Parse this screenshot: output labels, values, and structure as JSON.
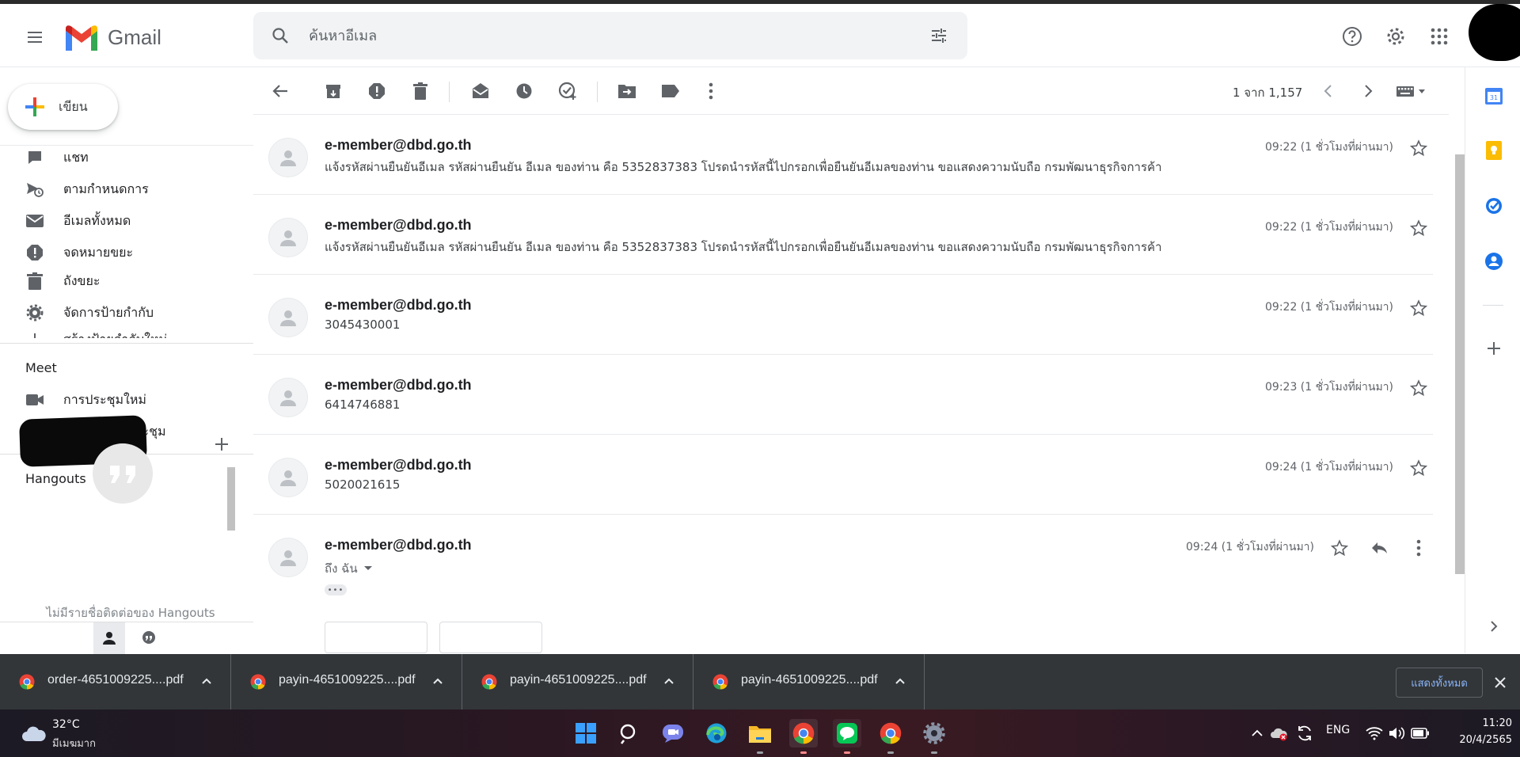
{
  "header": {
    "app_name": "Gmail",
    "search_placeholder": "ค้นหาอีเมล"
  },
  "compose": {
    "label": "เขียน"
  },
  "nav": {
    "items": [
      {
        "label": "แชท",
        "icon": "chat-icon"
      },
      {
        "label": "ตามกำหนดการ",
        "icon": "scheduled-icon"
      },
      {
        "label": "อีเมลทั้งหมด",
        "icon": "mail-icon"
      },
      {
        "label": "จดหมายขยะ",
        "icon": "spam-icon"
      },
      {
        "label": "ถังขยะ",
        "icon": "trash-icon"
      },
      {
        "label": "จัดการป้ายกำกับ",
        "icon": "gear-icon"
      },
      {
        "label": "สร้างป้ายกำกับใหม่",
        "icon": "plus-icon"
      }
    ]
  },
  "meet": {
    "title": "Meet",
    "items": [
      {
        "label": "การประชุมใหม่",
        "icon": "video-icon"
      },
      {
        "label": "เข้าร่วมการประชุม",
        "icon": "keyboard-icon"
      }
    ]
  },
  "hangouts": {
    "title": "Hangouts",
    "empty_text": "ไม่มีรายชื่อติดต่อของ Hangouts"
  },
  "toolbar": {
    "page_count": "1 จาก 1,157"
  },
  "messages": [
    {
      "from": "e-member@dbd.go.th",
      "snippet": "แจ้งรหัสผ่านยืนยันอีเมล รหัสผ่านยืนยัน อีเมล ของท่าน คือ 5352837383 โปรดนำรหัสนี้ไปกรอกเพื่อยืนยันอีเมลของท่าน ขอแสดงความนับถือ กรมพัฒนาธุรกิจการค้า",
      "time": "09:22 (1 ชั่วโมงที่ผ่านมา)"
    },
    {
      "from": "e-member@dbd.go.th",
      "snippet": "แจ้งรหัสผ่านยืนยันอีเมล รหัสผ่านยืนยัน อีเมล ของท่าน คือ 5352837383 โปรดนำรหัสนี้ไปกรอกเพื่อยืนยันอีเมลของท่าน ขอแสดงความนับถือ กรมพัฒนาธุรกิจการค้า",
      "time": "09:22 (1 ชั่วโมงที่ผ่านมา)"
    },
    {
      "from": "e-member@dbd.go.th",
      "snippet": "3045430001",
      "time": "09:22 (1 ชั่วโมงที่ผ่านมา)"
    },
    {
      "from": "e-member@dbd.go.th",
      "snippet": "6414746881",
      "time": "09:23 (1 ชั่วโมงที่ผ่านมา)"
    },
    {
      "from": "e-member@dbd.go.th",
      "snippet": "5020021615",
      "time": "09:24 (1 ชั่วโมงที่ผ่านมา)"
    },
    {
      "from": "e-member@dbd.go.th",
      "to": "ถึง ฉัน",
      "time": "09:24 (1 ชั่วโมงที่ผ่านมา)"
    }
  ],
  "downloads": {
    "items": [
      {
        "name": "order-4651009225....pdf"
      },
      {
        "name": "payin-4651009225....pdf"
      },
      {
        "name": "payin-4651009225....pdf"
      },
      {
        "name": "payin-4651009225....pdf"
      }
    ],
    "show_all": "แสดงทั้งหมด"
  },
  "taskbar": {
    "temperature": "32°C",
    "weather": "มีเมฆมาก",
    "language": "ENG",
    "time": "11:20",
    "date": "20/4/2565"
  },
  "colors": {
    "gmail_red": "#EA4335",
    "gmail_blue": "#4285F4",
    "gmail_yellow": "#FBBC04",
    "gmail_green": "#34A853",
    "download_bar": "#323639",
    "show_all_text": "#8ab4f8"
  }
}
